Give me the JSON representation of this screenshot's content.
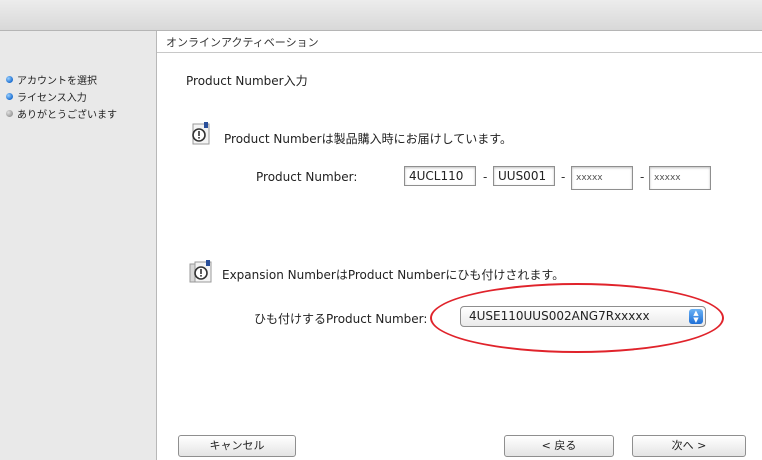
{
  "window": {
    "header": "オンラインアクティベーション"
  },
  "sidebar": {
    "steps": [
      {
        "label": "アカウントを選択",
        "state": "done"
      },
      {
        "label": "ライセンス入力",
        "state": "current"
      },
      {
        "label": "ありがとうございます",
        "state": "pending"
      }
    ]
  },
  "main": {
    "section_title": "Product Number入力",
    "product_info": "Product Numberは製品購入時にお届けしています。",
    "product_number_label": "Product Number:",
    "product_number_parts": [
      "4UCL110",
      "UUS001",
      "xxxxx",
      "xxxxx"
    ],
    "separator": "-",
    "expansion_info": "Expansion NumberはProduct Numberにひも付けされます。",
    "link_label": "ひも付けするProduct Number:",
    "link_value": "4USE110UUS002ANG7Rxxxxx"
  },
  "buttons": {
    "cancel": "キャンセル",
    "back": "< 戻る",
    "next": "次へ >"
  },
  "colors": {
    "highlight": "#e0232b",
    "accent": "#1f6fd6"
  }
}
